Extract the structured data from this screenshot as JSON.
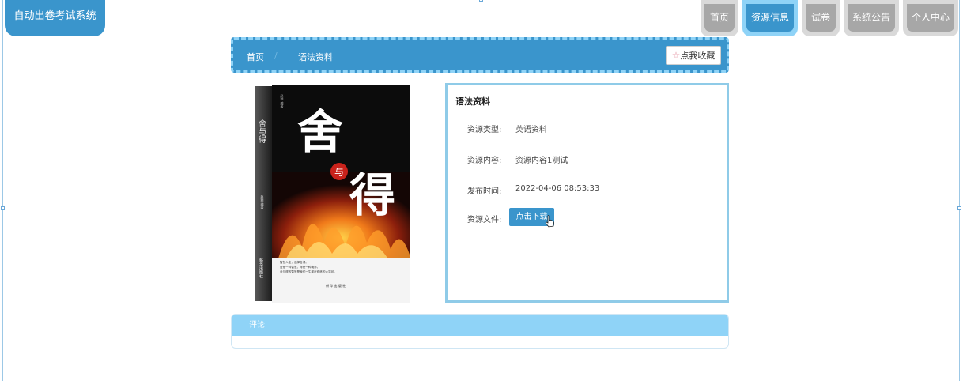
{
  "app": {
    "title": "自动出卷考试系统"
  },
  "nav": [
    {
      "label": "首页",
      "active": false
    },
    {
      "label": "资源信息",
      "active": true
    },
    {
      "label": "试卷",
      "active": false
    },
    {
      "label": "系统公告",
      "active": false
    },
    {
      "label": "个人中心",
      "active": false
    }
  ],
  "breadcrumb": {
    "home": "首页",
    "separator": "/",
    "current": "语法资料"
  },
  "favorite": {
    "icon": "star-icon",
    "label": "点我收藏"
  },
  "cover": {
    "author": "赵颖 编著",
    "vertical_title": "舍与得",
    "big_char_1": "舍",
    "small_char": "与",
    "big_char_2": "得",
    "author_bottom": "赵颖 编著",
    "publisher": "新华出版社",
    "blurb": [
      "智慧人生，选择舍得。",
      "舍是一种智慧，得是一种境界。",
      "舍与得的智慧是我们一生都在修炼的大学问。"
    ],
    "footer": "新 华 出 版 社"
  },
  "detail": {
    "title": "语法资料",
    "rows": [
      {
        "label": "资源类型:",
        "value": "英语资料"
      },
      {
        "label": "资源内容:",
        "value": "资源内容1测试"
      },
      {
        "label": "发布时间:",
        "value": "2022-04-06 08:53:33"
      }
    ],
    "file_label": "资源文件:",
    "download_label": "点击下载"
  },
  "comments": {
    "title": "评论"
  },
  "colors": {
    "primary": "#3a95cc",
    "light": "#8fd3f7",
    "inactive_tab": "#a7a7a7"
  }
}
